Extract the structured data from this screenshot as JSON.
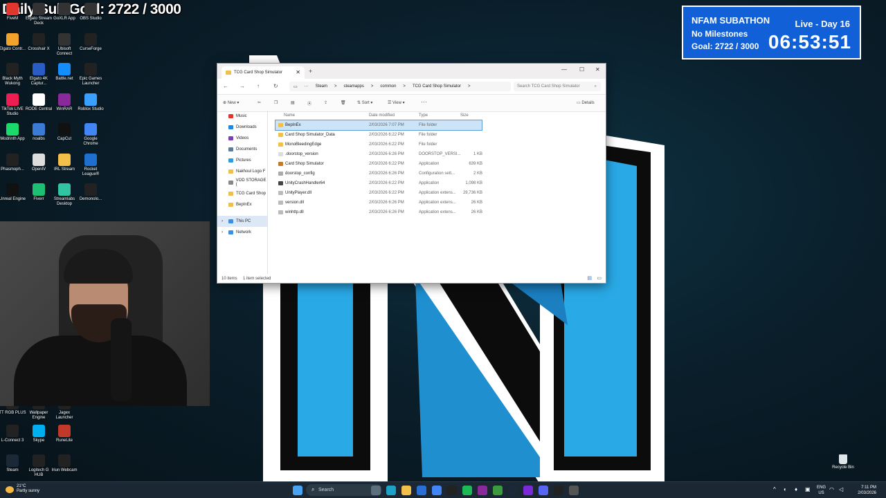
{
  "sub_goal": "Daily Sub Goal: 2722 / 3000",
  "subathon": {
    "title": "NFAM SUBATHON",
    "live": "Live - Day 16",
    "milestones": "No Milestones",
    "goal": "Goal: 2722 / 3000",
    "timer": "06:53:51",
    "color": "#1160d8"
  },
  "desktop_icons": [
    {
      "label": "FiveM",
      "color": "#e2372e"
    },
    {
      "label": "Elgato Stream Deck",
      "color": "#333"
    },
    {
      "label": "GoXLR App",
      "color": "#333"
    },
    {
      "label": "OBS Studio",
      "color": "#333"
    },
    {
      "label": "Elgato Contr...",
      "color": "#f3a32b"
    },
    {
      "label": "Crosshair X",
      "color": "#222"
    },
    {
      "label": "Ubisoft Connect",
      "color": "#333"
    },
    {
      "label": "CurseForge",
      "color": "#222"
    },
    {
      "label": "Black Myth Wukong",
      "color": "#222"
    },
    {
      "label": "Elgato 4K Captur...",
      "color": "#2a5cc8"
    },
    {
      "label": "Battle.net",
      "color": "#148eff"
    },
    {
      "label": "Epic Games Launcher",
      "color": "#222"
    },
    {
      "label": "TikTok LIVE Studio",
      "color": "#ee1d52"
    },
    {
      "label": "RODE Central",
      "color": "#fff"
    },
    {
      "label": "WinRAR",
      "color": "#8a2a9a"
    },
    {
      "label": "Roblox Studio",
      "color": "#3aa0ff"
    },
    {
      "label": "Modrinth App",
      "color": "#1bd96a"
    },
    {
      "label": "noalbs",
      "color": "#3b7bd6"
    },
    {
      "label": "CapCut",
      "color": "#111"
    },
    {
      "label": "Google Chrome",
      "color": "#4285f4"
    },
    {
      "label": "Phasmoph...",
      "color": "#222"
    },
    {
      "label": "OpenIV",
      "color": "#ddd"
    },
    {
      "label": "IRL Stream",
      "color": "#f2c04a"
    },
    {
      "label": "Rocket League®",
      "color": "#1f6fd1"
    },
    {
      "label": "Unreal Engine",
      "color": "#111"
    },
    {
      "label": "Fiverr",
      "color": "#1dbf73"
    },
    {
      "label": "Streamlabs Desktop",
      "color": "#31c3a2"
    },
    {
      "label": "Demonolo...",
      "color": "#222"
    }
  ],
  "desktop_icons_lower": [
    {
      "label": "TT RGB PLUS",
      "color": "#222"
    },
    {
      "label": "Wallpaper Engine",
      "color": "#222"
    },
    {
      "label": "Jagex Launcher",
      "color": "#222"
    },
    {
      "label": "L-Connect 3",
      "color": "#222"
    },
    {
      "label": "Skype",
      "color": "#00aff0"
    },
    {
      "label": "RuneLite",
      "color": "#c0392b"
    },
    {
      "label": "Steam",
      "color": "#1b2838"
    },
    {
      "label": "Logitech G HUB",
      "color": "#222"
    },
    {
      "label": "Iriun Webcam",
      "color": "#222"
    }
  ],
  "recycle_bin": "Recycle Bin",
  "explorer": {
    "tab_title": "TCG Card Shop Simulator",
    "breadcrumbs": [
      "Steam",
      ">",
      "steamapps",
      ">",
      "common",
      ">",
      "TCG Card Shop Simulator",
      ">"
    ],
    "search_placeholder": "Search TCG Card Shop Simulator",
    "toolbar": {
      "new": "New",
      "sort": "Sort",
      "view": "View",
      "more": "···",
      "details": "Details"
    },
    "sidebar": [
      {
        "label": "Music",
        "color": "#e2372e"
      },
      {
        "label": "Downloads",
        "color": "#1e88e5"
      },
      {
        "label": "Videos",
        "color": "#7b3fb3"
      },
      {
        "label": "Documents",
        "color": "#5d7c9c"
      },
      {
        "label": "Pictures",
        "color": "#2f9be0"
      },
      {
        "label": "Nakhoul Logo F",
        "color": "#f2c04a"
      },
      {
        "label": "VOD STORAGE (",
        "color": "#888"
      },
      {
        "label": "TCG Card Shop",
        "color": "#f2c04a"
      },
      {
        "label": "BepInEx",
        "color": "#f2c04a"
      }
    ],
    "this_pc": "This PC",
    "network": "Network",
    "columns": {
      "name": "Name",
      "date": "Date modified",
      "type": "Type",
      "size": "Size"
    },
    "files": [
      {
        "name": "BepInEx",
        "date": "2/03/2026 7:07 PM",
        "type": "File folder",
        "size": "",
        "color": "#f2c04a"
      },
      {
        "name": "Card Shop Simulator_Data",
        "date": "2/03/2026 6:22 PM",
        "type": "File folder",
        "size": "",
        "color": "#f2c04a"
      },
      {
        "name": "MonoBleedingEdge",
        "date": "2/03/2026 6:22 PM",
        "type": "File folder",
        "size": "",
        "color": "#f2c04a"
      },
      {
        "name": ".doorstop_version",
        "date": "2/03/2026 6:26 PM",
        "type": "DOORSTOP_VERSI...",
        "size": "1 KB",
        "color": "#ddd"
      },
      {
        "name": "Card Shop Simulator",
        "date": "2/03/2026 6:22 PM",
        "type": "Application",
        "size": "639 KB",
        "color": "#c47a2c"
      },
      {
        "name": "doorstop_config",
        "date": "2/03/2026 6:26 PM",
        "type": "Configuration sett...",
        "size": "2 KB",
        "color": "#aaa"
      },
      {
        "name": "UnityCrashHandler64",
        "date": "2/03/2026 6:22 PM",
        "type": "Application",
        "size": "1,098 KB",
        "color": "#444"
      },
      {
        "name": "UnityPlayer.dll",
        "date": "2/03/2026 6:22 PM",
        "type": "Application extens...",
        "size": "29,736 KB",
        "color": "#bbb"
      },
      {
        "name": "version.dll",
        "date": "2/03/2026 6:26 PM",
        "type": "Application extens...",
        "size": "26 KB",
        "color": "#bbb"
      },
      {
        "name": "winhttp.dll",
        "date": "2/03/2026 6:26 PM",
        "type": "Application extens...",
        "size": "26 KB",
        "color": "#bbb"
      }
    ],
    "status_count": "10 items",
    "status_selected": "1 item selected"
  },
  "taskbar": {
    "weather_temp": "21°C",
    "weather_desc": "Partly sunny",
    "search": "Search",
    "lang1": "ENG",
    "lang2": "US",
    "time": "7:11 PM",
    "date": "2/03/2026"
  }
}
